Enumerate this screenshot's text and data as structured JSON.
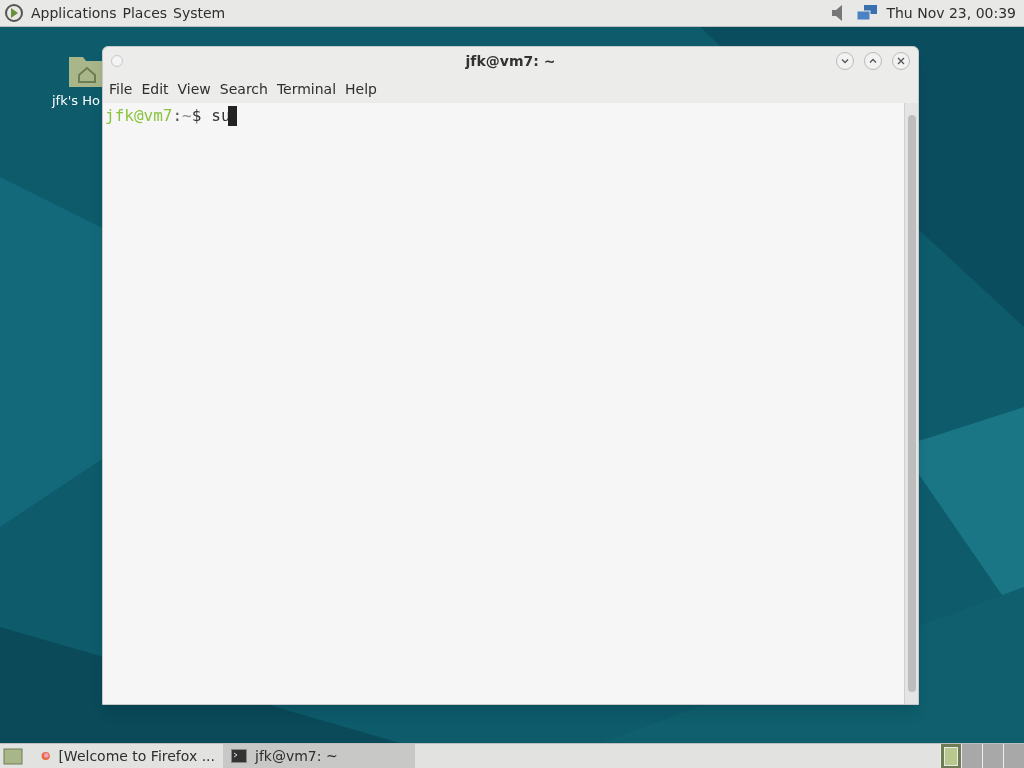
{
  "top_panel": {
    "menus": [
      "Applications",
      "Places",
      "System"
    ],
    "clock": "Thu Nov 23, 00:39"
  },
  "desktop_icons": [
    {
      "label": "jfk's Ho"
    }
  ],
  "window": {
    "title": "jfk@vm7: ~",
    "menu": [
      "File",
      "Edit",
      "View",
      "Search",
      "Terminal",
      "Help"
    ],
    "terminal": {
      "user_host": "jfk@vm7",
      "separator": ":",
      "path": "~",
      "symbol": "$",
      "command": "su"
    }
  },
  "taskbar": {
    "tasks": [
      {
        "kind": "browser",
        "label": "[Welcome to Firefox ...",
        "selected": false
      },
      {
        "kind": "terminal",
        "label": "jfk@vm7: ~",
        "selected": true
      }
    ],
    "workspaces": [
      {
        "selected": true
      },
      {
        "selected": false
      },
      {
        "selected": false
      },
      {
        "selected": false
      }
    ]
  }
}
